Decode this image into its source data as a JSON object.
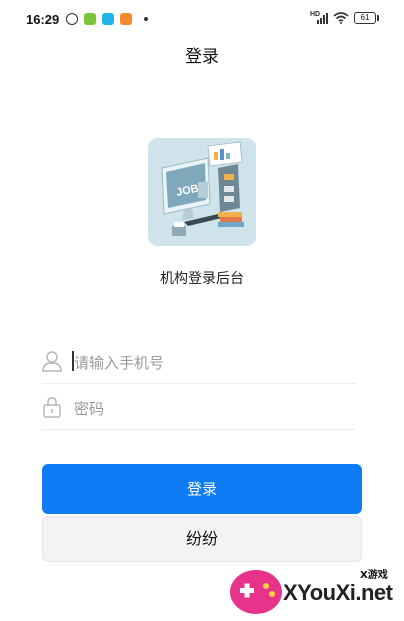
{
  "status_bar": {
    "time": "16:29",
    "hd_label": "HD",
    "battery": "61",
    "icons": [
      "alarm-icon",
      "green-app-icon",
      "blue-app-icon",
      "orange-app-icon",
      "signal-icon",
      "wifi-icon",
      "battery-icon"
    ]
  },
  "header": {
    "title": "登录"
  },
  "logo": {
    "label_text": "JOB",
    "icon": "job-illustration"
  },
  "org_label": "机构登录后台",
  "form": {
    "phone_placeholder": "请输入手机号",
    "password_placeholder": "密码",
    "phone_icon": "user-icon",
    "password_icon": "lock-icon"
  },
  "buttons": {
    "login_label": "登录",
    "second_label": "纷纷"
  },
  "watermark": {
    "brand": "XYouXi.net",
    "small": "X游戏"
  },
  "colors": {
    "primary": "#0f7cf5",
    "secondary_button": "#f3f3f3",
    "placeholder": "#9a9a9a",
    "logo_bg": "#cfe3ea"
  }
}
